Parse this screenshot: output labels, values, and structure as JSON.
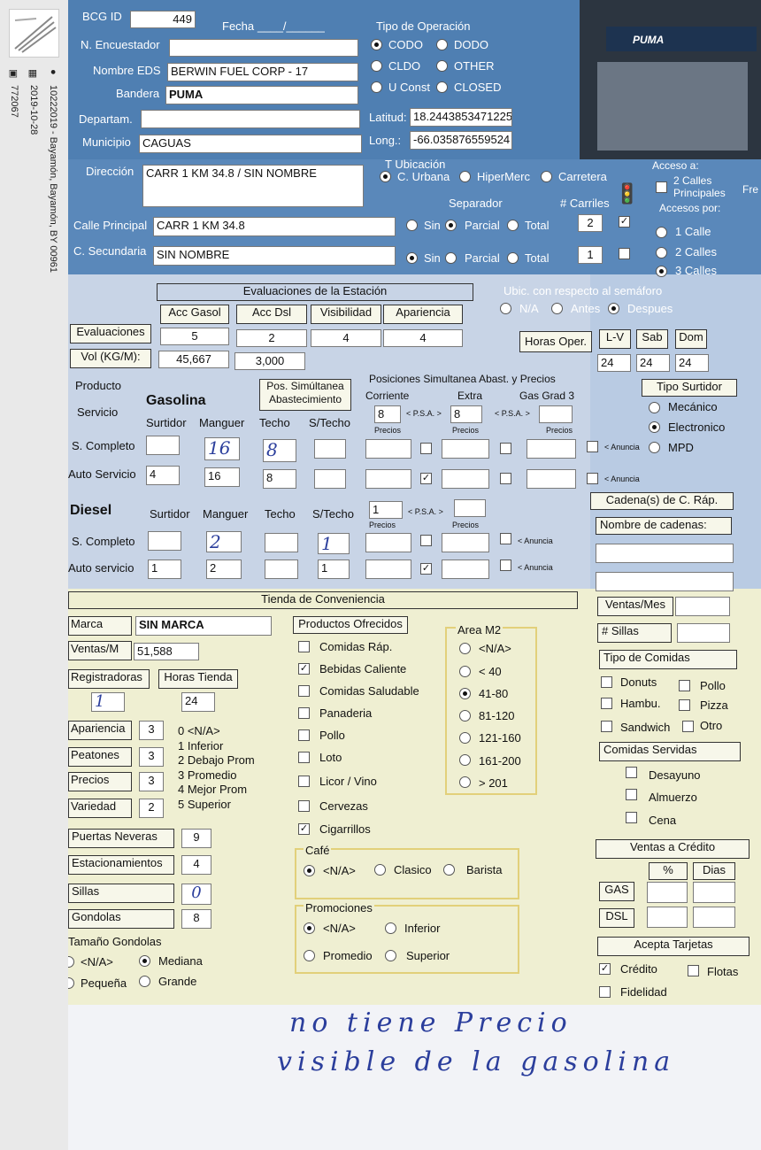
{
  "sidebar": {
    "caption_id": "10222019 - Bayamón, Bayamón, BY 00961",
    "date": "2019-10-28",
    "number": "772067",
    "icons": [
      "location-pin-icon",
      "calendar-icon",
      "id-card-icon"
    ]
  },
  "header": {
    "bcg_id_label": "BCG ID",
    "bcg_id": "449",
    "fecha_label": "Fecha",
    "fecha_value": "____/______",
    "encuestador_label": "N. Encuestador",
    "nombre_label": "Nombre EDS",
    "nombre": "BERWIN FUEL CORP - 17",
    "bandera_label": "Bandera",
    "bandera": "PUMA",
    "departam_label": "Departam.",
    "municipio_label": "Municipio",
    "municipio": "CAGUAS",
    "direccion_label": "Dirección",
    "direccion": "CARR 1 KM 34.8 / SIN NOMBRE",
    "calle_label": "Calle Principal",
    "calle": "CARR 1 KM 34.8",
    "secundaria_label": "C. Secundaria",
    "secundaria": "SIN NOMBRE",
    "puma_logo": "PUMA"
  },
  "operacion": {
    "title": "Tipo de Operación",
    "options": [
      "CODO",
      "DODO",
      "CLDO",
      "OTHER",
      "U Const",
      "CLOSED"
    ],
    "selected": "CODO"
  },
  "geo": {
    "lat_label": "Latitud:",
    "lat": "18.2443853471225",
    "long_label": "Long.:",
    "long": "-66.035876559524"
  },
  "ubicacion": {
    "title": "T Ubicación",
    "options": [
      "C. Urbana",
      "HiperMerc",
      "Carretera"
    ],
    "selected": "C. Urbana"
  },
  "separador": {
    "title": "Separador",
    "carriles_title": "# Carriles",
    "options": [
      "Sin",
      "Parcial",
      "Total"
    ],
    "row1_selected": "Parcial",
    "row2_selected": "Sin",
    "row1_carriles": "2",
    "row2_carriles": "1"
  },
  "acceso": {
    "title": "Acceso a:",
    "calles_principales": "2 Calles Principales",
    "accesos_title": "Accesos por:",
    "options": [
      "1 Calle",
      "2 Calles",
      "3 Calles"
    ],
    "selected": "3 Calles",
    "fre": "Fre"
  },
  "semaforo": {
    "title": "Ubic. con respecto al semáforo",
    "options": [
      "N/A",
      "Antes",
      "Despues"
    ],
    "selected": "Despues"
  },
  "evaluaciones": {
    "title": "Evaluaciones de la Estación",
    "columns": [
      "Acc Gasol",
      "Acc Dsl",
      "Visibilidad",
      "Apariencia"
    ],
    "row_label": "Evaluaciones",
    "values": [
      "5",
      "2",
      "4",
      "4"
    ],
    "vol_label": "Vol (KG/M):",
    "vol_gas": "45,667",
    "vol_dsl": "3,000"
  },
  "horas": {
    "label": "Horas Oper.",
    "columns": [
      "L-V",
      "Sab",
      "Dom"
    ],
    "values": [
      "24",
      "24",
      "24"
    ]
  },
  "servicio": {
    "producto": "Producto",
    "servicio": "Servicio",
    "gasolina": "Gasolina",
    "pos_simultanea": "Pos. Simúltanea Abastecimiento",
    "posiciones_title": "Posiciones Simultanea Abast. y Precios",
    "cols": [
      "Surtidor",
      "Manguer",
      "Techo",
      "S/Techo"
    ],
    "prices": [
      "Corriente",
      "Extra",
      "Gas Grad 3"
    ],
    "corriente": "8",
    "extra": "8",
    "psa": "< P.S.A. >",
    "precios": "Precios",
    "anuncia": "< Anuncia",
    "s_completo": "S. Completo",
    "auto_servicio": "Auto Servicio",
    "sc_manguer": "16",
    "sc_techo": "8",
    "as_surtidor": "4",
    "as_manguer": "16",
    "as_techo": "8"
  },
  "tipo_surtidor": {
    "title": "Tipo Surtidor",
    "options": [
      "Mecánico",
      "Electronico",
      "MPD"
    ],
    "selected": "Electronico"
  },
  "diesel": {
    "title": "Diesel",
    "cols": [
      "Surtidor",
      "Manguer",
      "Techo",
      "S/Techo"
    ],
    "psa_value": "1",
    "psa": "< P.S.A. >",
    "precios": "Precios",
    "anuncia": "< Anuncia",
    "s_completo": "S. Completo",
    "auto_servicio": "Auto servicio",
    "sc_manguer": "2",
    "sc_stecho": "1",
    "as_surtidor": "1",
    "as_manguer": "2",
    "as_stecho": "1"
  },
  "cadena": {
    "title": "Cadena(s) de C. Ráp.",
    "nombre": "Nombre de cadenas:",
    "ventas_mes": "Ventas/Mes",
    "sillas": "# Sillas",
    "tipo_comidas": "Tipo de Comidas",
    "tipos": [
      "Donuts",
      "Pollo",
      "Hambu.",
      "Pizza",
      "Sandwich",
      "Otro"
    ],
    "servidas_title": "Comidas Servidas",
    "servidas": [
      "Desayuno",
      "Almuerzo",
      "Cena"
    ]
  },
  "tienda": {
    "title": "Tienda de Conveniencia",
    "marca_label": "Marca",
    "marca": "SIN MARCA",
    "ventas_label": "Ventas/M",
    "ventas": "51,588",
    "registradoras_label": "Registradoras",
    "registradoras": "1",
    "horas_label": "Horas Tienda",
    "horas": "24",
    "ratings": [
      {
        "label": "Apariencia",
        "value": "3"
      },
      {
        "label": "Peatones",
        "value": "3"
      },
      {
        "label": "Precios",
        "value": "3"
      },
      {
        "label": "Variedad",
        "value": "2"
      }
    ],
    "scale": [
      "0 <N/A>",
      "1 Inferior",
      "2 Debajo Prom",
      "3 Promedio",
      "4 Mejor Prom",
      "5 Superior"
    ],
    "counts": [
      {
        "label": "Puertas Neveras",
        "value": "9"
      },
      {
        "label": "Estacionamientos",
        "value": "4"
      },
      {
        "label": "Sillas",
        "value": "0"
      },
      {
        "label": "Gondolas",
        "value": "8"
      }
    ],
    "tam_title": "Tamaño Gondolas",
    "tam_options": [
      "<N/A>",
      "Mediana",
      "Pequeña",
      "Grande"
    ],
    "tam_selected": "Mediana"
  },
  "productos": {
    "title": "Productos Ofrecidos",
    "items": [
      {
        "label": "Comidas Ráp.",
        "checked": false
      },
      {
        "label": "Bebidas Caliente",
        "checked": true
      },
      {
        "label": "Comidas Saludable",
        "checked": false
      },
      {
        "label": "Panaderia",
        "checked": false
      },
      {
        "label": "Pollo",
        "checked": false
      },
      {
        "label": "Loto",
        "checked": false
      },
      {
        "label": "Licor / Vino",
        "checked": false
      },
      {
        "label": "Cervezas",
        "checked": false
      },
      {
        "label": "Cigarrillos",
        "checked": true
      }
    ]
  },
  "area": {
    "title": "Area M2",
    "options": [
      "<N/A>",
      "< 40",
      "41-80",
      "81-120",
      "121-160",
      "161-200",
      "> 201"
    ],
    "selected": "41-80"
  },
  "cafe": {
    "title": "Café",
    "options": [
      "<N/A>",
      "Clasico",
      "Barista"
    ],
    "selected": "<N/A>"
  },
  "promociones": {
    "title": "Promociones",
    "options": [
      "<N/A>",
      "Inferior",
      "Promedio",
      "Superior"
    ],
    "selected": "<N/A>"
  },
  "credito": {
    "title": "Ventas a Crédito",
    "pct": "%",
    "dias": "Dias",
    "gas": "GAS",
    "dsl": "DSL"
  },
  "tarjetas": {
    "title": "Acepta Tarjetas",
    "credito": "Crédito",
    "flotas": "Flotas",
    "fidelidad": "Fidelidad"
  },
  "handwritten": {
    "line1": "no tiene Precio",
    "line2": "visible de la gasolina"
  }
}
